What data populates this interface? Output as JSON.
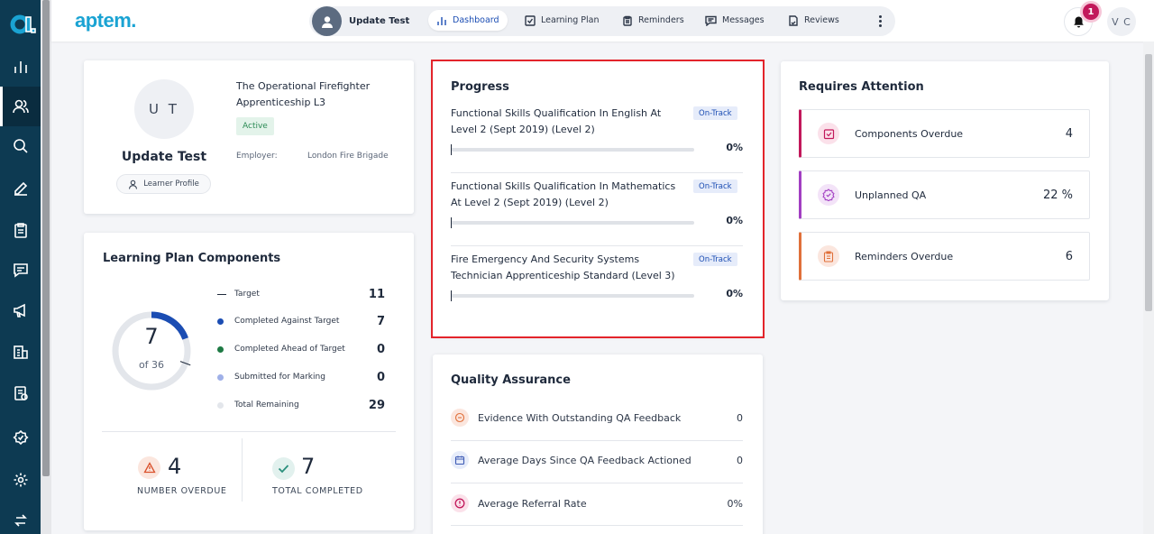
{
  "app": {
    "brand": "aptem."
  },
  "topbar": {
    "user_name": "Update Test",
    "tabs": [
      {
        "label": "Dashboard",
        "icon": "chart-bars-icon"
      },
      {
        "label": "Learning Plan",
        "icon": "checkbox-icon"
      },
      {
        "label": "Reminders",
        "icon": "clipboard-icon"
      },
      {
        "label": "Messages",
        "icon": "message-icon"
      },
      {
        "label": "Reviews",
        "icon": "review-icon"
      }
    ],
    "notification_count": "1",
    "initials": "V C"
  },
  "sidebar": {
    "items": [
      {
        "icon": "bar-chart-icon"
      },
      {
        "icon": "users-icon",
        "active": true
      },
      {
        "icon": "search-icon"
      },
      {
        "icon": "pen-icon"
      },
      {
        "icon": "clipboard-list-icon"
      },
      {
        "icon": "chat-icon"
      },
      {
        "icon": "megaphone-icon"
      },
      {
        "icon": "building-chart-icon"
      },
      {
        "icon": "report-icon"
      },
      {
        "icon": "badge-icon"
      },
      {
        "icon": "settings-icon"
      },
      {
        "icon": "switch-icon"
      }
    ]
  },
  "profile": {
    "initials": "U T",
    "name": "Update Test",
    "learner_profile_label": "Learner Profile",
    "programme": "The Operational Firefighter Apprenticeship L3",
    "status": "Active",
    "employer_label": "Employer:",
    "employer": "London Fire Brigade"
  },
  "learning_plan": {
    "title": "Learning Plan Components",
    "completed": "7",
    "of_total": "of 36",
    "total": 36,
    "legend": [
      {
        "label": "Target",
        "value": "11",
        "color": "#1f2a3c",
        "kind": "dash"
      },
      {
        "label": "Completed Against Target",
        "value": "7",
        "color": "#1b4db3",
        "kind": "dot"
      },
      {
        "label": "Completed Ahead of Target",
        "value": "0",
        "color": "#1e7a44",
        "kind": "dot"
      },
      {
        "label": "Submitted for Marking",
        "value": "0",
        "color": "#9fb0e8",
        "kind": "dot"
      },
      {
        "label": "Total Remaining",
        "value": "29",
        "color": "#e3e6eb",
        "kind": "dot"
      }
    ],
    "overdue_value": "4",
    "overdue_label": "NUMBER OVERDUE",
    "completed_value": "7",
    "completed_label": "TOTAL COMPLETED"
  },
  "progress": {
    "title": "Progress",
    "items": [
      {
        "text": "Functional Skills Qualification In English At Level 2 (Sept 2019) (Level 2)",
        "status": "On-Track",
        "percent": "0%",
        "fraction": 0
      },
      {
        "text": "Functional Skills Qualification In Mathematics At Level 2 (Sept 2019) (Level 2)",
        "status": "On-Track",
        "percent": "0%",
        "fraction": 0
      },
      {
        "text": "Fire Emergency And Security Systems Technician Apprenticeship Standard (Level 3)",
        "status": "On-Track",
        "percent": "0%",
        "fraction": 0
      }
    ]
  },
  "quality": {
    "title": "Quality Assurance",
    "rows": [
      {
        "label": "Evidence With Outstanding QA Feedback",
        "value": "0",
        "icon": "feedback-icon",
        "color": "#e0703a"
      },
      {
        "label": "Average Days Since QA Feedback Actioned",
        "value": "0",
        "icon": "calendar-icon",
        "color": "#3d5bb5"
      },
      {
        "label": "Average Referral Rate",
        "value": "0%",
        "icon": "alert-icon",
        "color": "#c2185b"
      }
    ]
  },
  "attention": {
    "title": "Requires Attention",
    "rows": [
      {
        "label": "Components Overdue",
        "value": "4",
        "icon": "checklist-icon",
        "color": "#c2185b"
      },
      {
        "label": "Unplanned QA",
        "value": "22 %",
        "icon": "verified-icon",
        "color": "#a23fc2"
      },
      {
        "label": "Reminders Overdue",
        "value": "6",
        "icon": "clipboard-icon",
        "color": "#e0703a"
      }
    ]
  }
}
